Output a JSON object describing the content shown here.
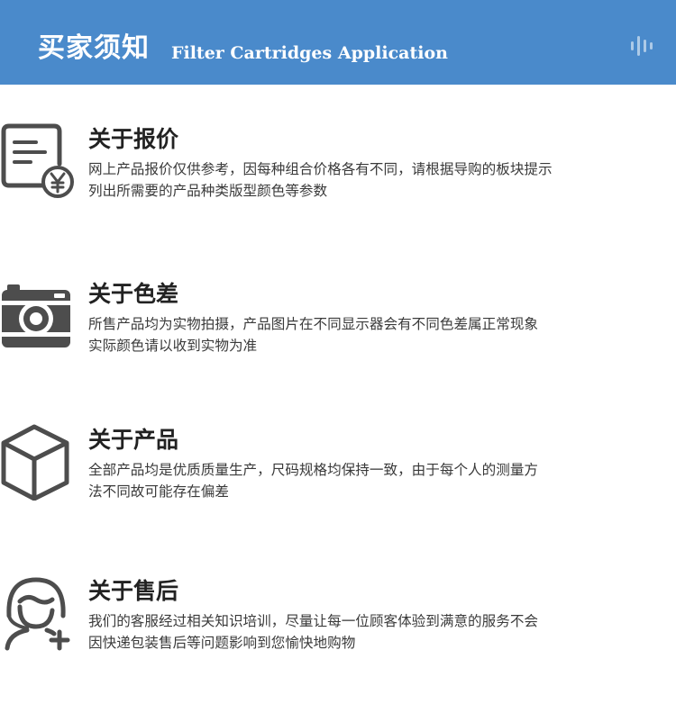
{
  "header": {
    "title": "买家须知",
    "subtitle": "Filter Cartridges Application"
  },
  "sections": [
    {
      "icon": "price-tag-yen-document-icon",
      "title": "关于报价",
      "lines": [
        "网上产品报价仅供参考，因每种组合价格各有不同，请根据导购的板块提示",
        "列出所需要的产品种类版型颜色等参数"
      ]
    },
    {
      "icon": "camera-icon",
      "title": "关于色差",
      "lines": [
        "所售产品均为实物拍摄，产品图片在不同显示器会有不同色差属正常现象",
        "实际颜色请以收到实物为准"
      ]
    },
    {
      "icon": "box-cube-icon",
      "title": "关于产品",
      "lines": [
        "全部产品均是优质质量生产，尺码规格均保持一致，由于每个人的测量方",
        "法不同故可能存在偏差"
      ]
    },
    {
      "icon": "customer-service-person-plus-icon",
      "title": "关于售后",
      "lines": [
        "我们的客服经过相关知识培训，尽量让每一位顾客体验到满意的服务不会",
        "因快递包装售后等问题影响到您愉快地购物"
      ]
    }
  ],
  "colors": {
    "header_bg": "#4a8acb",
    "icon": "#4d4d4d",
    "title": "#222222",
    "text": "#3a3a3a"
  }
}
